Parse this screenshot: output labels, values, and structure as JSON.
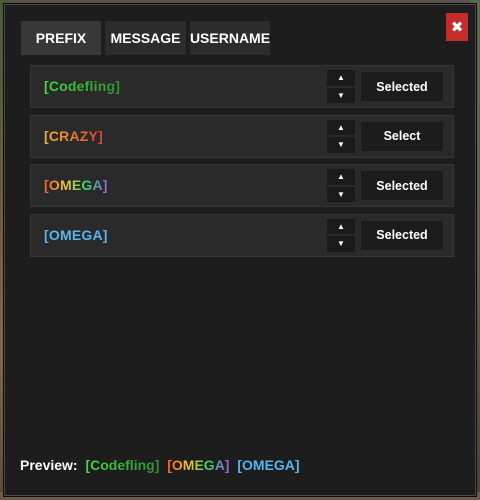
{
  "tabs": [
    {
      "label": "PREFIX",
      "active": true
    },
    {
      "label": "MESSAGE",
      "active": false
    },
    {
      "label": "USERNAME",
      "active": false
    }
  ],
  "close": {
    "label": "✖"
  },
  "arrows": {
    "up": "▲",
    "down": "▼"
  },
  "prefixes": [
    {
      "name": "[Codefling]",
      "button": "Selected",
      "colors": [
        "#3ddc3d",
        "#2f8f2f"
      ]
    },
    {
      "name": "[CRAZY]",
      "button": "Select",
      "colors": [
        "#f2b233",
        "#e0412b"
      ]
    },
    {
      "name": "[OMEGA]",
      "button": "Selected",
      "colors": [
        "#ff5a1f",
        "#f0c43a",
        "#35d66a",
        "#9b59e8"
      ]
    },
    {
      "name": "[OMEGA]",
      "button": "Selected",
      "colors": [
        "#56b7f0",
        "#56b7f0"
      ]
    }
  ],
  "preview": {
    "label": "Preview:",
    "items": [
      {
        "text": "[Codefling]",
        "colors": [
          "#3ddc3d",
          "#2f8f2f"
        ]
      },
      {
        "text": "[OMEGA]",
        "colors": [
          "#ff5a1f",
          "#f0c43a",
          "#35d66a",
          "#9b59e8"
        ]
      },
      {
        "text": "[OMEGA]",
        "colors": [
          "#56b7f0",
          "#56b7f0"
        ]
      }
    ]
  }
}
